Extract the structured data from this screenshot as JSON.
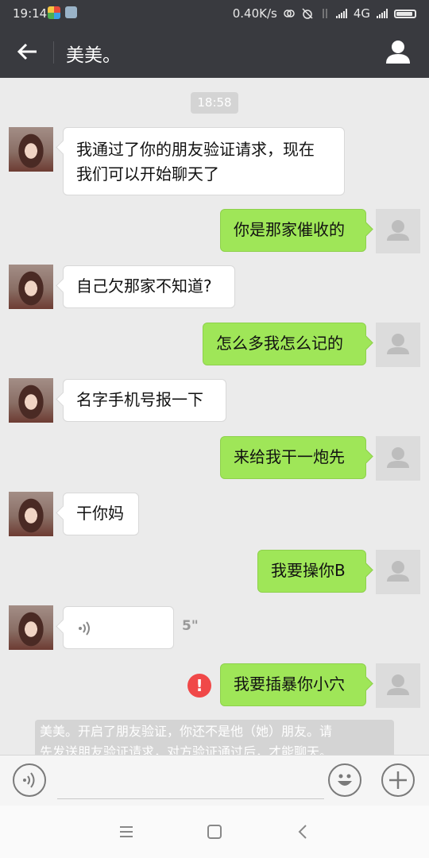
{
  "status_bar": {
    "time": "19:14",
    "network_speed": "0.40K/s",
    "network_type": "4G"
  },
  "header": {
    "title": "美美。"
  },
  "chat": {
    "timestamp": "18:58",
    "messages": [
      {
        "dir": "in",
        "type": "text",
        "line1": "我通过了你的朋友验证请求，现在",
        "line2": "我们可以开始聊天了"
      },
      {
        "dir": "out",
        "type": "text",
        "text": "你是那家催收的"
      },
      {
        "dir": "in",
        "type": "text",
        "text": "自己欠那家不知道?"
      },
      {
        "dir": "out",
        "type": "text",
        "text": "怎么多我怎么记的"
      },
      {
        "dir": "in",
        "type": "text",
        "text": "名字手机号报一下"
      },
      {
        "dir": "out",
        "type": "text",
        "text": "来给我干一炮先"
      },
      {
        "dir": "in",
        "type": "text",
        "text": "干你妈"
      },
      {
        "dir": "out",
        "type": "text",
        "text": "我要操你B"
      },
      {
        "dir": "in",
        "type": "voice",
        "duration": "5\""
      },
      {
        "dir": "out",
        "type": "text",
        "text": "我要插暴你小穴",
        "failed": true,
        "error_mark": "!"
      }
    ],
    "system_notice": {
      "line1": "美美。开启了朋友验证，你还不是他（她）朋友。请",
      "line2": "先发送朋友验证请求，对方验证通过后，才能聊天。"
    }
  },
  "input_bar": {
    "placeholder": ""
  },
  "colors": {
    "header_bg": "#393a3f",
    "chat_bg": "#ebebeb",
    "outgoing_bubble": "#9fe658",
    "incoming_bubble": "#ffffff",
    "error_red": "#f04848"
  }
}
